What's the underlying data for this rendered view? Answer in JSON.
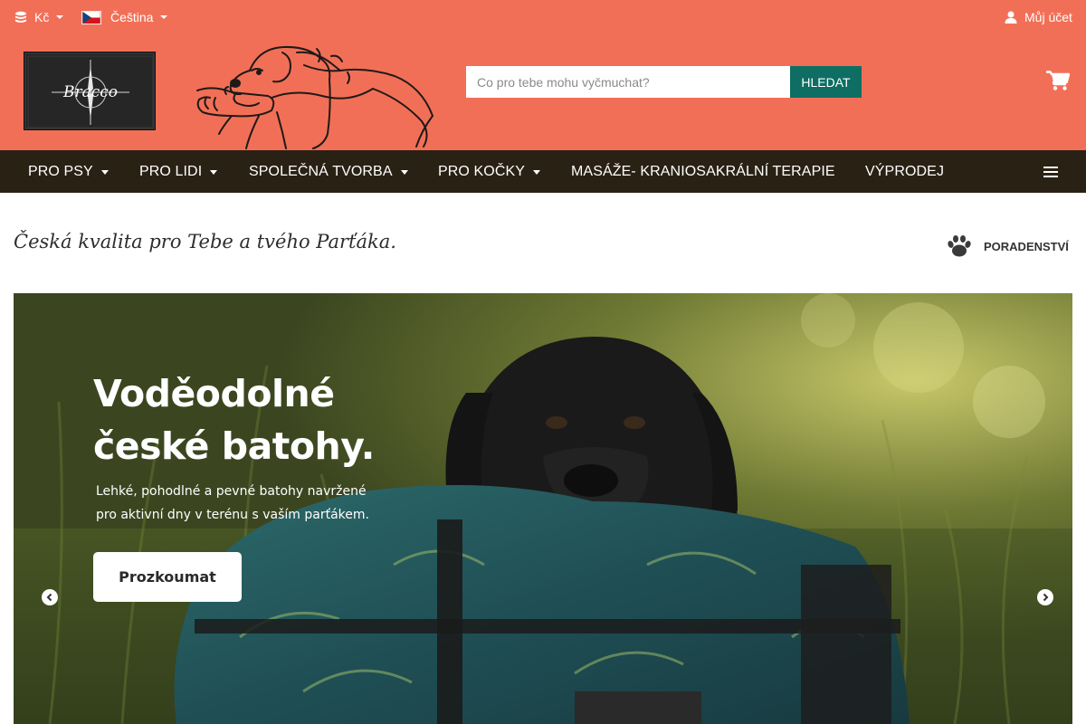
{
  "topbar": {
    "currency": {
      "label": "Kč",
      "icon": "coins-icon"
    },
    "language": {
      "label": "Čeština",
      "icon": "czech-flag-icon"
    },
    "account": {
      "label": "Můj účet",
      "icon": "user-icon"
    }
  },
  "logo": {
    "text": "Bracco"
  },
  "search": {
    "placeholder": "Co pro tebe mohu vyčmuchat?",
    "button": "HLEDAT"
  },
  "cart": {
    "icon": "shopping-cart-icon"
  },
  "nav": {
    "items": [
      {
        "label": "PRO PSY",
        "dropdown": true
      },
      {
        "label": "PRO LIDI",
        "dropdown": true
      },
      {
        "label": "SPOLEČNÁ TVORBA",
        "dropdown": true
      },
      {
        "label": "PRO KOČKY",
        "dropdown": true
      },
      {
        "label": "MASÁŽE- KRANIOSAKRÁLNÍ TERAPIE",
        "dropdown": false
      },
      {
        "label": "VÝPRODEJ",
        "dropdown": false
      }
    ],
    "menu_icon": "hamburger-icon"
  },
  "tagline": "Česká kvalita pro Tebe a tvého Parťáka.",
  "advice": {
    "label": "PORADENSTVÍ",
    "icon": "paw-icon"
  },
  "hero": {
    "title_line1": "Voděodolné",
    "title_line2": "české batohy.",
    "subtitle_line1": "Lehké, pohodlné a pevné batohy navržené",
    "subtitle_line2": "pro aktivní dny v terénu s vaším parťákem.",
    "button": "Prozkoumat",
    "prev_icon": "arrow-left-icon",
    "next_icon": "arrow-right-icon"
  },
  "colors": {
    "header_bg": "#f26f57",
    "nav_bg": "#2a2115",
    "search_button": "#0e6e63"
  }
}
